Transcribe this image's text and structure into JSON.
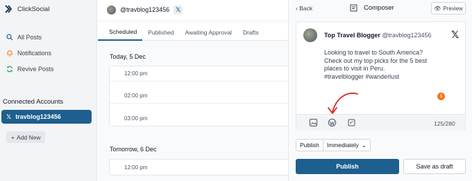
{
  "app": {
    "name": "ClickSocial"
  },
  "sidebar": {
    "items": [
      {
        "label": "All Posts",
        "icon": "search-icon"
      },
      {
        "label": "Notifications",
        "icon": "bell-icon"
      },
      {
        "label": "Revive Posts",
        "icon": "refresh-icon"
      }
    ],
    "section_title": "Connected Accounts",
    "account": {
      "name": "travblog123456",
      "icon": "x-icon"
    },
    "add_new": "Add New"
  },
  "main": {
    "handle": "@travblog123456",
    "platform_badge": "𝕏",
    "tabs": [
      "Scheduled",
      "Published",
      "Awaiting Approval",
      "Drafts"
    ],
    "active_tab": "Scheduled",
    "days": [
      {
        "label": "Today, 5 Dec",
        "slots": [
          "12:00 pm",
          "02:00 pm",
          "03:00 pm"
        ]
      },
      {
        "label": "Tomorrow, 6 Dec",
        "slots": [
          "12:00 pm"
        ]
      }
    ]
  },
  "composer": {
    "back": "Back",
    "title": "Composer",
    "preview": "Preview",
    "post": {
      "name": "Top Travel Blogger",
      "handle": "@travblog123456",
      "platform_icon": "𝕏",
      "body_lines": [
        "Looking to travel to South America?",
        "Check out my top picks for the 5 best",
        "places to visit in Peru.",
        "#travelblogger #wanderlust"
      ],
      "badge_count": "1",
      "char_count": "125/280"
    },
    "publish_label": "Publish",
    "publish_timing": "Immediately",
    "publish_button": "Publish",
    "draft_button": "Save as draft",
    "colors": {
      "primary": "#1d5f8e",
      "annotation_arrow": "#dc2626",
      "badge": "#f97316"
    }
  }
}
